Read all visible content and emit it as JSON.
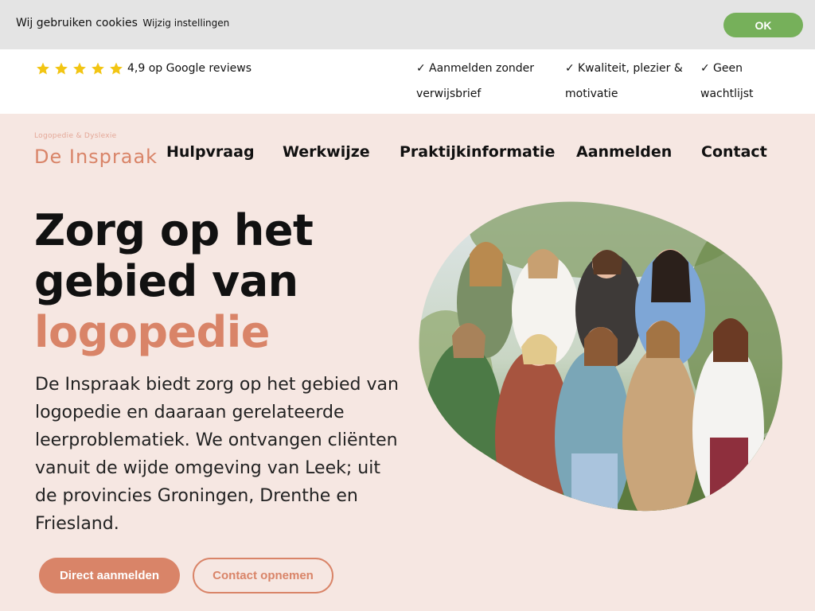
{
  "cookie": {
    "text": "Wij gebruiken cookies",
    "link": "Wijzig instellingen",
    "ok_label": "OK"
  },
  "usp_bar": {
    "rating_text": "4,9 op Google reviews",
    "rating_stars": 5,
    "items": [
      {
        "check": "✓",
        "line1": "Aanmelden zonder",
        "line2": "verwijsbrief"
      },
      {
        "check": "✓",
        "line1": "Kwaliteit, plezier &",
        "line2": "motivatie"
      },
      {
        "check": "✓",
        "line1": "Geen",
        "line2": "wachtlijst"
      }
    ]
  },
  "logo": {
    "small": "Logopedie & Dyslexie",
    "main": "De Inspraak"
  },
  "nav": {
    "items": [
      "Hulpvraag",
      "Werkwijze",
      "Praktijkinformatie",
      "Aanmelden",
      "Contact"
    ]
  },
  "hero": {
    "title_line1": "Zorg op het",
    "title_line2": "gebied van",
    "title_accent": "logopedie",
    "description": "De Inspraak biedt zorg op het gebied van logopedie en daaraan gerelateerde leerproblematiek. We ontvangen cliënten vanuit de wijde omgeving van Leek; uit de provincies Groningen, Drenthe en Friesland.",
    "primary_button": "Direct aanmelden",
    "secondary_button": "Contact opnemen"
  },
  "colors": {
    "accent": "#d98468",
    "background": "#f6e7e2",
    "ok_green": "#76b05a",
    "star": "#f2c513"
  }
}
